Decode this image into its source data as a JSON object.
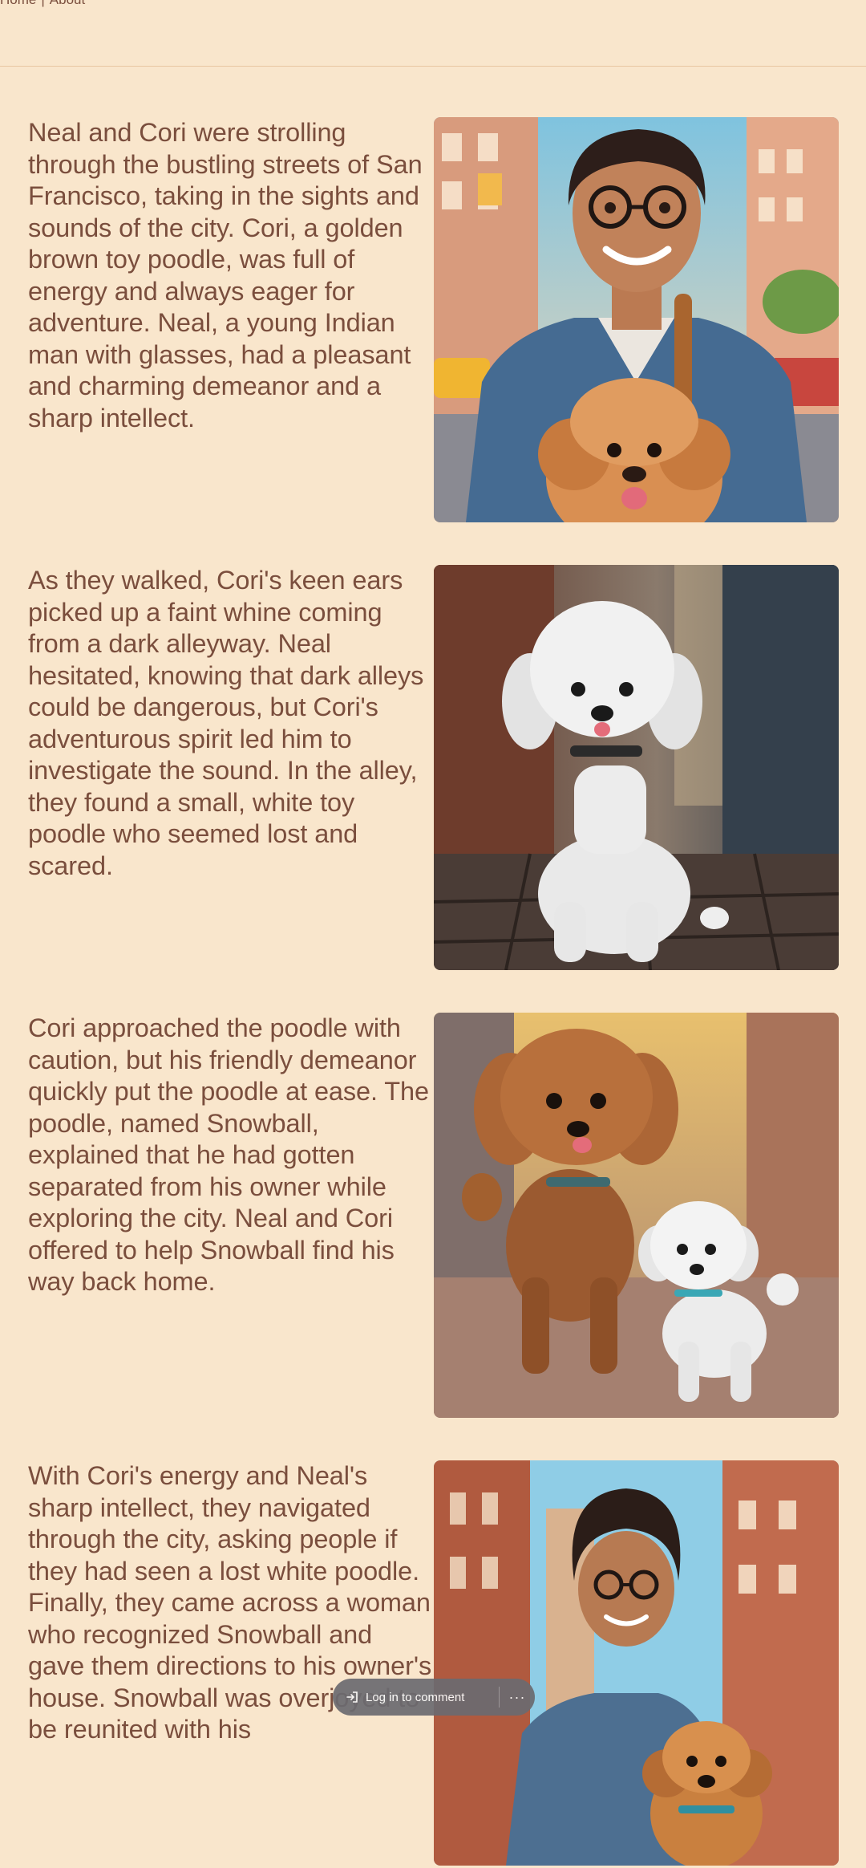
{
  "nav": {
    "home_label": "Home",
    "separator": "|",
    "about_label": "About"
  },
  "stories": [
    {
      "text": "Neal and Cori were strolling through the bustling streets of San Francisco, taking in the sights and sounds of the city. Cori, a golden brown toy poodle, was full of energy and always eager for adventure. Neal, a young Indian man with glasses, had a pleasant and charming demeanor and a sharp intellect."
    },
    {
      "text": "As they walked, Cori's keen ears picked up a faint whine coming from a dark alleyway. Neal hesitated, knowing that dark alleys could be dangerous, but Cori's adventurous spirit led him to investigate the sound. In the alley, they found a small, white toy poodle who seemed lost and scared."
    },
    {
      "text": "Cori approached the poodle with caution, but his friendly demeanor quickly put the poodle at ease. The poodle, named Snowball, explained that he had gotten separated from his owner while exploring the city. Neal and Cori offered to help Snowball find his way back home."
    },
    {
      "text": "With Cori's energy and Neal's sharp intellect, they navigated through the city, asking people if they had seen a lost white poodle. Finally, they came across a woman who recognized Snowball and gave them directions to his owner's house. Snowball was overjoyed to be reunited with his"
    }
  ],
  "comment_bar": {
    "login_label": "Log in to comment",
    "more_label": "···"
  },
  "colors": {
    "background": "#f9e6cc",
    "text": "#7a4e3d",
    "divider": "#e8c6a2",
    "comment_bar": "#6b6b70"
  }
}
